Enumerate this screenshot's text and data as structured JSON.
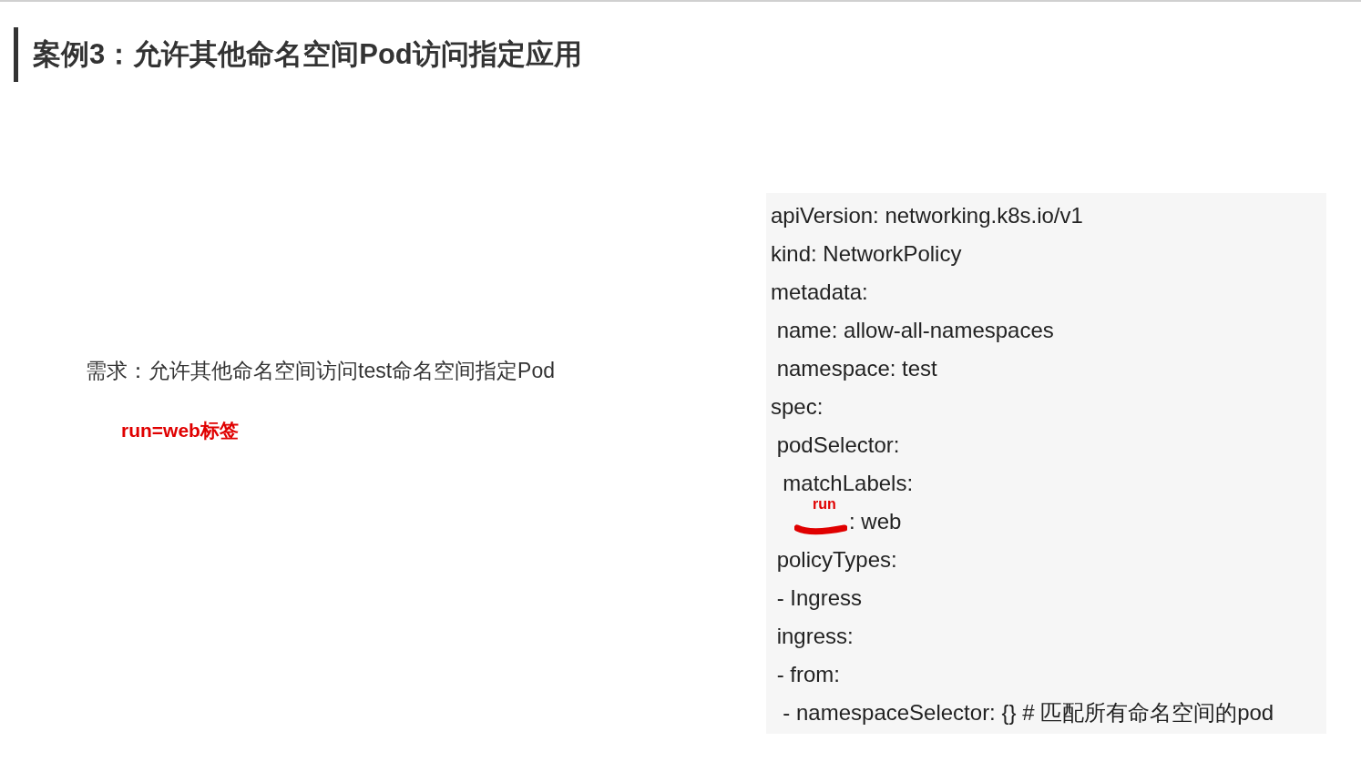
{
  "title": "案例3：允许其他命名空间Pod访问指定应用",
  "requirement": "需求：允许其他命名空间访问test命名空间指定Pod",
  "note": "run=web标签",
  "code_lines": [
    {
      "kind": "plain",
      "text": "apiVersion: networking.k8s.io/v1"
    },
    {
      "kind": "plain",
      "text": "kind: NetworkPolicy"
    },
    {
      "kind": "plain",
      "text": "metadata:"
    },
    {
      "kind": "plain",
      "text": " name: allow-all-namespaces"
    },
    {
      "kind": "plain",
      "text": " namespace: test"
    },
    {
      "kind": "plain",
      "text": "spec:"
    },
    {
      "kind": "plain",
      "text": " podSelector:"
    },
    {
      "kind": "plain",
      "text": "  matchLabels:"
    },
    {
      "kind": "annotated",
      "text": ": web",
      "annotation": "run"
    },
    {
      "kind": "plain",
      "text": " policyTypes:"
    },
    {
      "kind": "plain",
      "text": " - Ingress"
    },
    {
      "kind": "plain",
      "text": " ingress:"
    },
    {
      "kind": "plain",
      "text": " - from:"
    },
    {
      "kind": "plain",
      "text": "  - namespaceSelector: {} # 匹配所有命名空间的pod"
    }
  ]
}
